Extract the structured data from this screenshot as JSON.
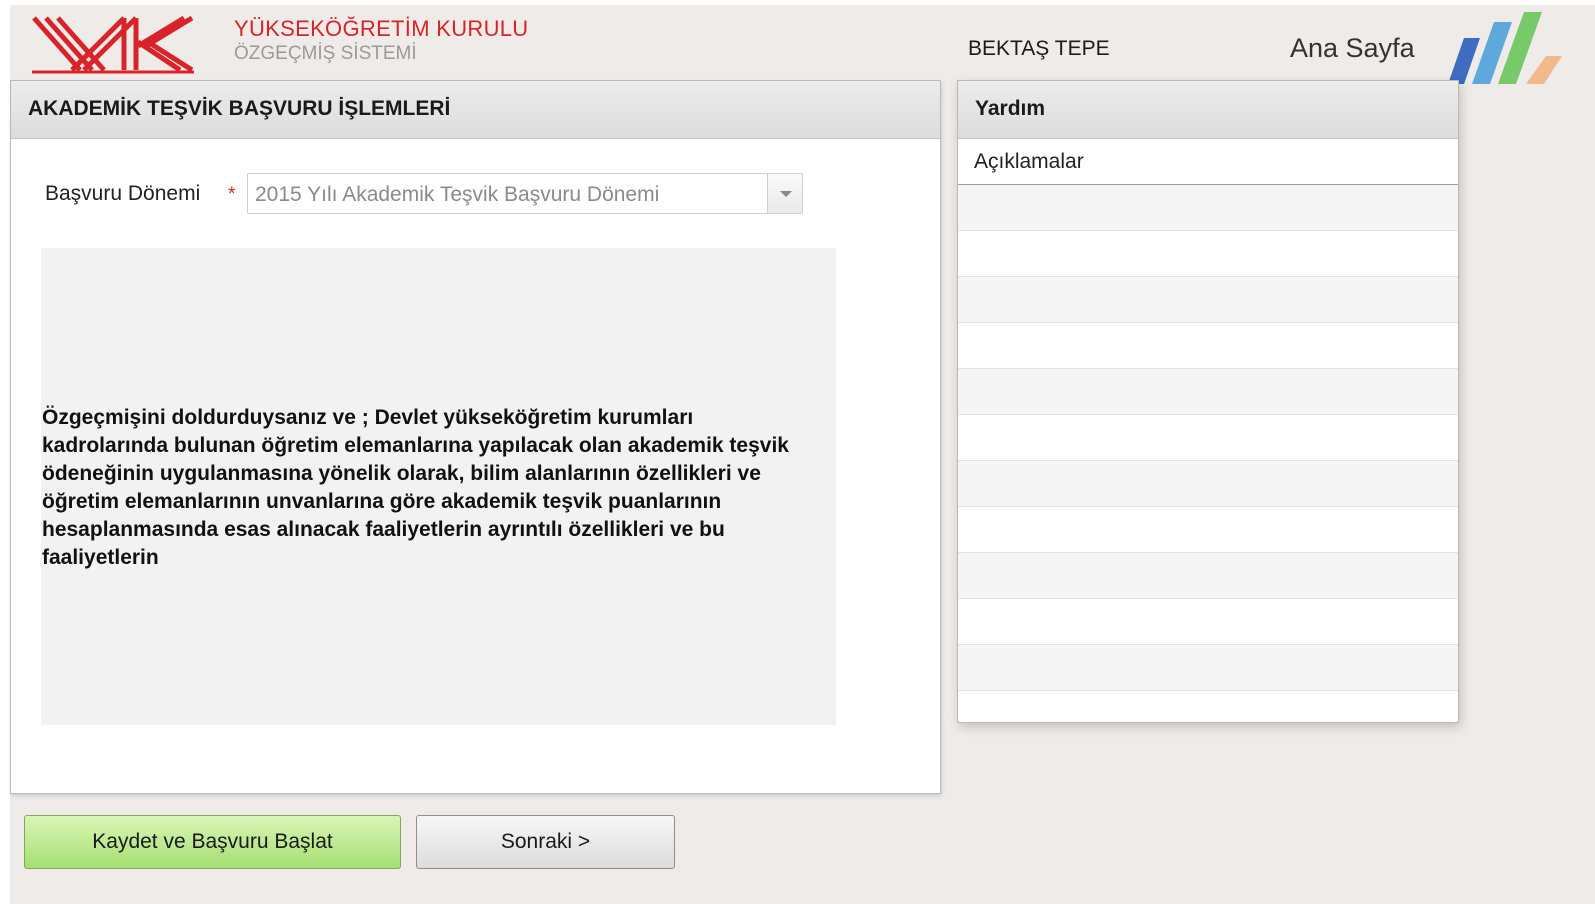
{
  "header": {
    "org_title": "YÜKSEKÖĞRETİM KURULU",
    "org_subtitle": "ÖZGEÇMİŞ SİSTEMİ",
    "user_name": "BEKTAŞ TEPE",
    "home_link": "Ana Sayfa",
    "logo_icon": "yok-logo-icon",
    "brand_color": "#d8232a",
    "stripe_colors": [
      "#3e6cc3",
      "#5fa8db",
      "#78c96a",
      "#f2b98a"
    ]
  },
  "main": {
    "title": "AKADEMİK TEŞVİK BAŞVURU İŞLEMLERİ",
    "field_label": "Başvuru Dönemi",
    "required_mark": "*",
    "select_value": "2015 Yılı Akademik Teşvik Başvuru Dönemi",
    "info_text": "Özgeçmişini doldurduysanız ve ; Devlet yükseköğretim kurumları kadrolarında bulunan öğretim elemanlarına yapılacak olan akademik teşvik ödeneğinin uygulanmasına yönelik olarak, bilim alanlarının özellikleri ve öğretim elemanlarının unvanlarına göre akademik teşvik puanlarının hesaplanmasında esas alınacak faaliyetlerin ayrıntılı özellikleri ve bu faaliyetlerin"
  },
  "help": {
    "title": "Yardım",
    "items": [
      "Açıklamalar"
    ]
  },
  "actions": {
    "save_label": "Kaydet ve Başvuru Başlat",
    "next_label": "Sonraki >"
  }
}
